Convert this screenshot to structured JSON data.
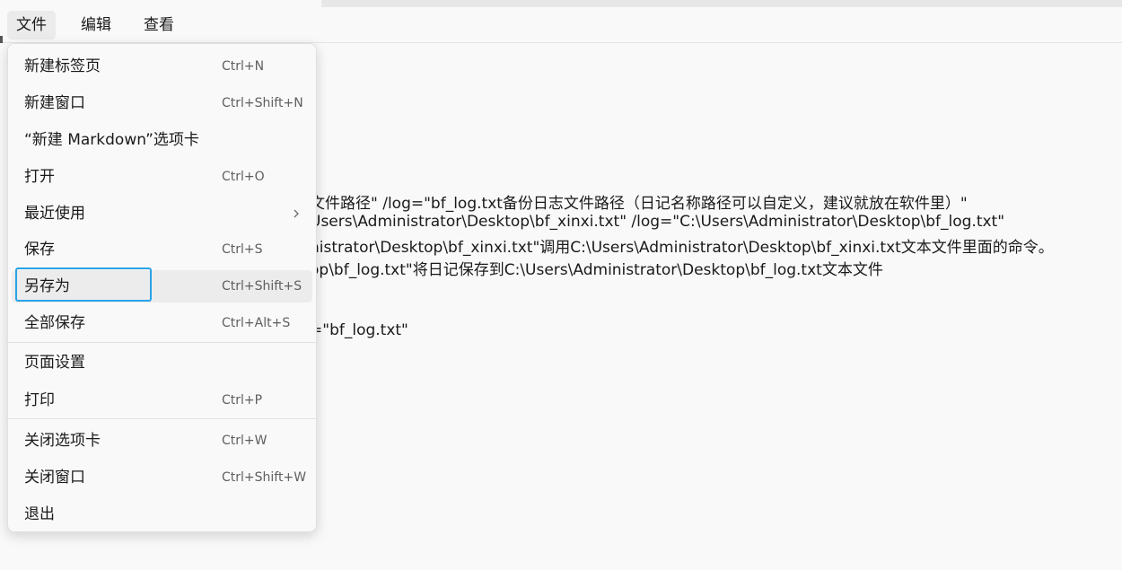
{
  "menubar": {
    "file": "文件",
    "edit": "编辑",
    "view": "查看"
  },
  "editor": {
    "lines": [
      "文件路径\" /log=\"bf_log.txt备份日志文件路径（日记名称路径可以自定义，建议就放在软件里）\"",
      "Users\\Administrator\\Desktop\\bf_xinxi.txt\" /log=\"C:\\Users\\Administrator\\Desktop\\bf_log.txt\"",
      "nistrator\\Desktop\\bf_xinxi.txt\"调用C:\\Users\\Administrator\\Desktop\\bf_xinxi.txt文本文件里面的命令。",
      "op\\bf_log.txt\"将日记保存到C:\\Users\\Administrator\\Desktop\\bf_log.txt文本文件",
      "=\"bf_log.txt\""
    ]
  },
  "file_menu": {
    "items": [
      {
        "label": "新建标签页",
        "shortcut": "Ctrl+N"
      },
      {
        "label": "新建窗口",
        "shortcut": "Ctrl+Shift+N"
      },
      {
        "label": "“新建 Markdown”选项卡",
        "shortcut": ""
      },
      {
        "label": "打开",
        "shortcut": "Ctrl+O"
      },
      {
        "label": "最近使用",
        "shortcut": ""
      },
      {
        "label": "保存",
        "shortcut": "Ctrl+S"
      },
      {
        "label": "另存为",
        "shortcut": "Ctrl+Shift+S"
      },
      {
        "label": "全部保存",
        "shortcut": "Ctrl+Alt+S"
      },
      {
        "label": "页面设置",
        "shortcut": ""
      },
      {
        "label": "打印",
        "shortcut": "Ctrl+P"
      },
      {
        "label": "关闭选项卡",
        "shortcut": "Ctrl+W"
      },
      {
        "label": "关闭窗口",
        "shortcut": "Ctrl+Shift+W"
      },
      {
        "label": "退出",
        "shortcut": ""
      }
    ]
  },
  "colors": {
    "focus_outline": "#29a3e8",
    "hover_background": "#ececec"
  },
  "icons": {
    "submenu": "chevron-right-icon"
  }
}
